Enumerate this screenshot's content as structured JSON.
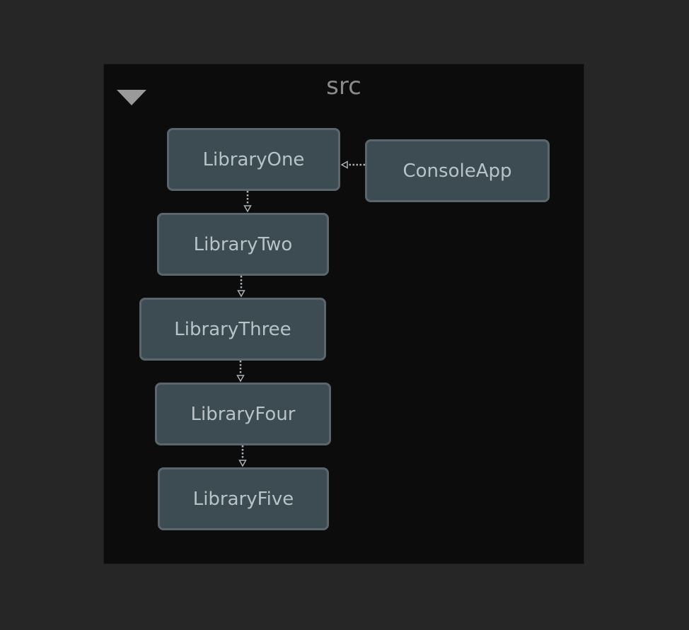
{
  "group": {
    "title": "src",
    "toggle_icon": "triangle-down-icon"
  },
  "nodes": [
    {
      "id": "LibraryOne",
      "label": "LibraryOne"
    },
    {
      "id": "LibraryTwo",
      "label": "LibraryTwo"
    },
    {
      "id": "LibraryThree",
      "label": "LibraryThree"
    },
    {
      "id": "LibraryFour",
      "label": "LibraryFour"
    },
    {
      "id": "LibraryFive",
      "label": "LibraryFive"
    },
    {
      "id": "ConsoleApp",
      "label": "ConsoleApp"
    }
  ],
  "edges": [
    {
      "from": "ConsoleApp",
      "to": "LibraryOne",
      "style": "dotted"
    },
    {
      "from": "LibraryOne",
      "to": "LibraryTwo",
      "style": "dotted"
    },
    {
      "from": "LibraryTwo",
      "to": "LibraryThree",
      "style": "dotted"
    },
    {
      "from": "LibraryThree",
      "to": "LibraryFour",
      "style": "dotted"
    },
    {
      "from": "LibraryFour",
      "to": "LibraryFive",
      "style": "dotted"
    }
  ],
  "colors": {
    "background": "#262626",
    "group_fill": "#0c0c0c",
    "node_fill": "#3d4b52",
    "node_border": "#5a666c",
    "node_text": "#b8c3c8",
    "edge": "#a9b1b5",
    "title_text": "#8a8a8a"
  }
}
